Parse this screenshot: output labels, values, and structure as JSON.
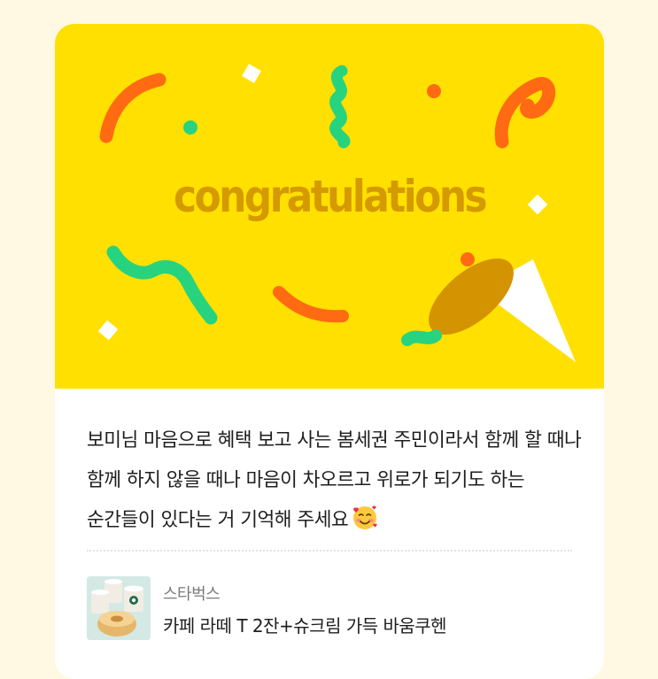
{
  "banner": {
    "title": "congratulations",
    "background_color": "#FFE000",
    "title_color": "#D49A00",
    "confetti_colors": [
      "#FF6A13",
      "#27D37F",
      "#FFFFFF"
    ]
  },
  "message": {
    "text": "보미님 마음으로 혜택 보고 사는 봄세권 주민이라서 함께 할 때나 함께 하지 않을 때나 마음이 차오르고 위로가 되기도 하는 순간들이 있다는 거 기억해 주세요",
    "emoji_icon": "smiling-face-with-hearts-icon"
  },
  "gift": {
    "brand": "스타벅스",
    "product_name": "카페 라떼 T 2잔+슈크림 가득 바움쿠헨",
    "thumbnail_icon": "starbucks-latte-and-baumkuchen-image"
  }
}
